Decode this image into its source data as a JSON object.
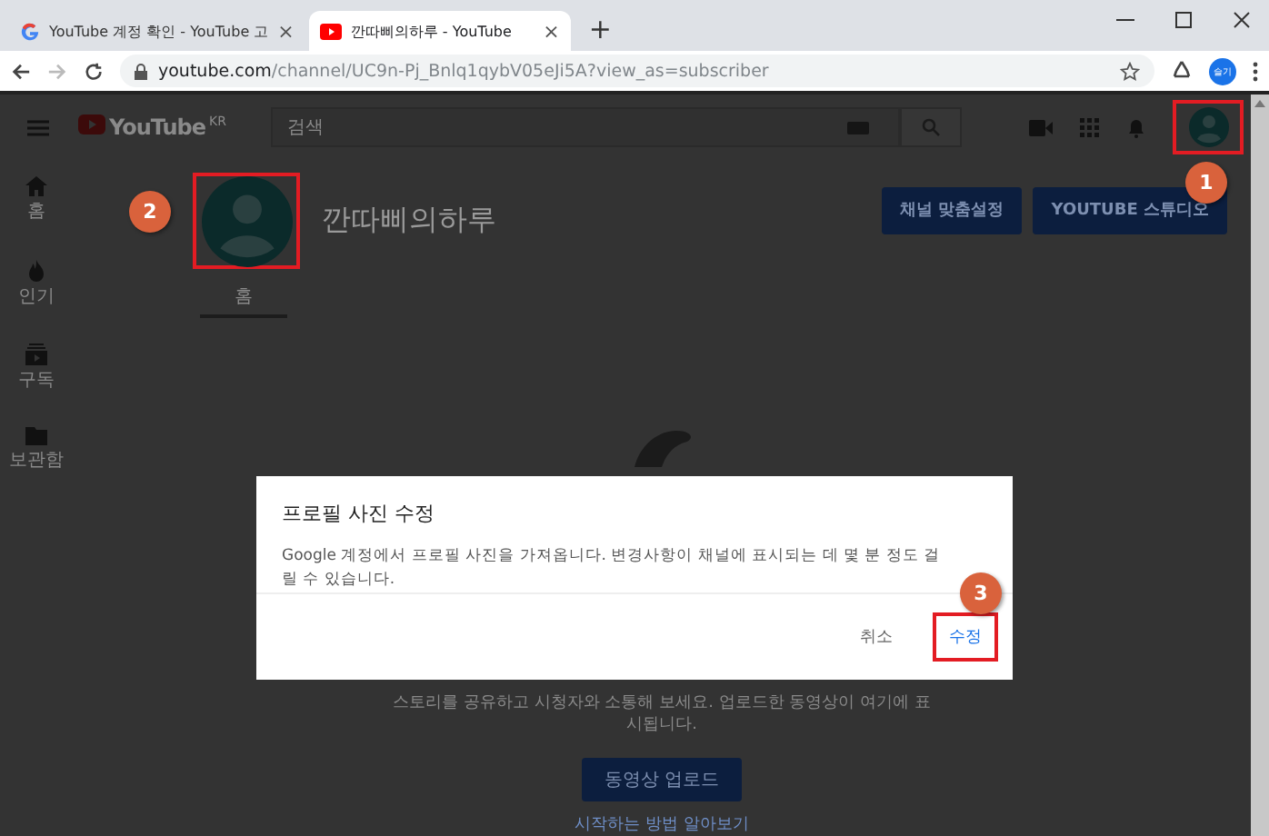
{
  "browser": {
    "tabs": [
      {
        "title": "YouTube 계정 확인 - YouTube 고",
        "selected": false,
        "close": "×"
      },
      {
        "title": "깐따삐의하루 - YouTube",
        "selected": true,
        "close": "×"
      }
    ],
    "new_tab": "+",
    "url_host": "youtube.com",
    "url_path": "/channel/UC9n-Pj_Bnlq1qybV05eJi5A?view_as=subscriber",
    "forward_disabled": true,
    "profile": "슬기"
  },
  "masthead": {
    "logo": "YouTube",
    "region": "KR",
    "search": {
      "placeholder": "검색"
    }
  },
  "sidebar": {
    "items": [
      {
        "label": "홈"
      },
      {
        "label": "인기"
      },
      {
        "label": "구독"
      },
      {
        "label": "보관함"
      }
    ]
  },
  "channel": {
    "name": "깐따삐의하루",
    "buttons": [
      "채널 맞춤설정",
      "YOUTUBE 스튜디오"
    ],
    "tabs": [
      {
        "label": "홈",
        "selected": true
      }
    ]
  },
  "empty_state": {
    "message": "스토리를 공유하고 시청자와 소통해 보세요. 업로드한 동영상이 여기에 표시됩니다.",
    "button": "동영상 업로드",
    "link": "시작하는 방법 알아보기"
  },
  "dialog": {
    "title": "프로필 사진 수정",
    "body": "Google 계정에서 프로필 사진을 가져옵니다. 변경사항이 채널에 표시되는 데 몇 분 정도 걸릴 수 있습니다.",
    "buttons": [
      {
        "label": "취소",
        "kind": "cancel"
      },
      {
        "label": "수정",
        "kind": "confirm"
      }
    ]
  },
  "annotations": [
    {
      "number": "1"
    },
    {
      "number": "2"
    },
    {
      "number": "3"
    }
  ]
}
